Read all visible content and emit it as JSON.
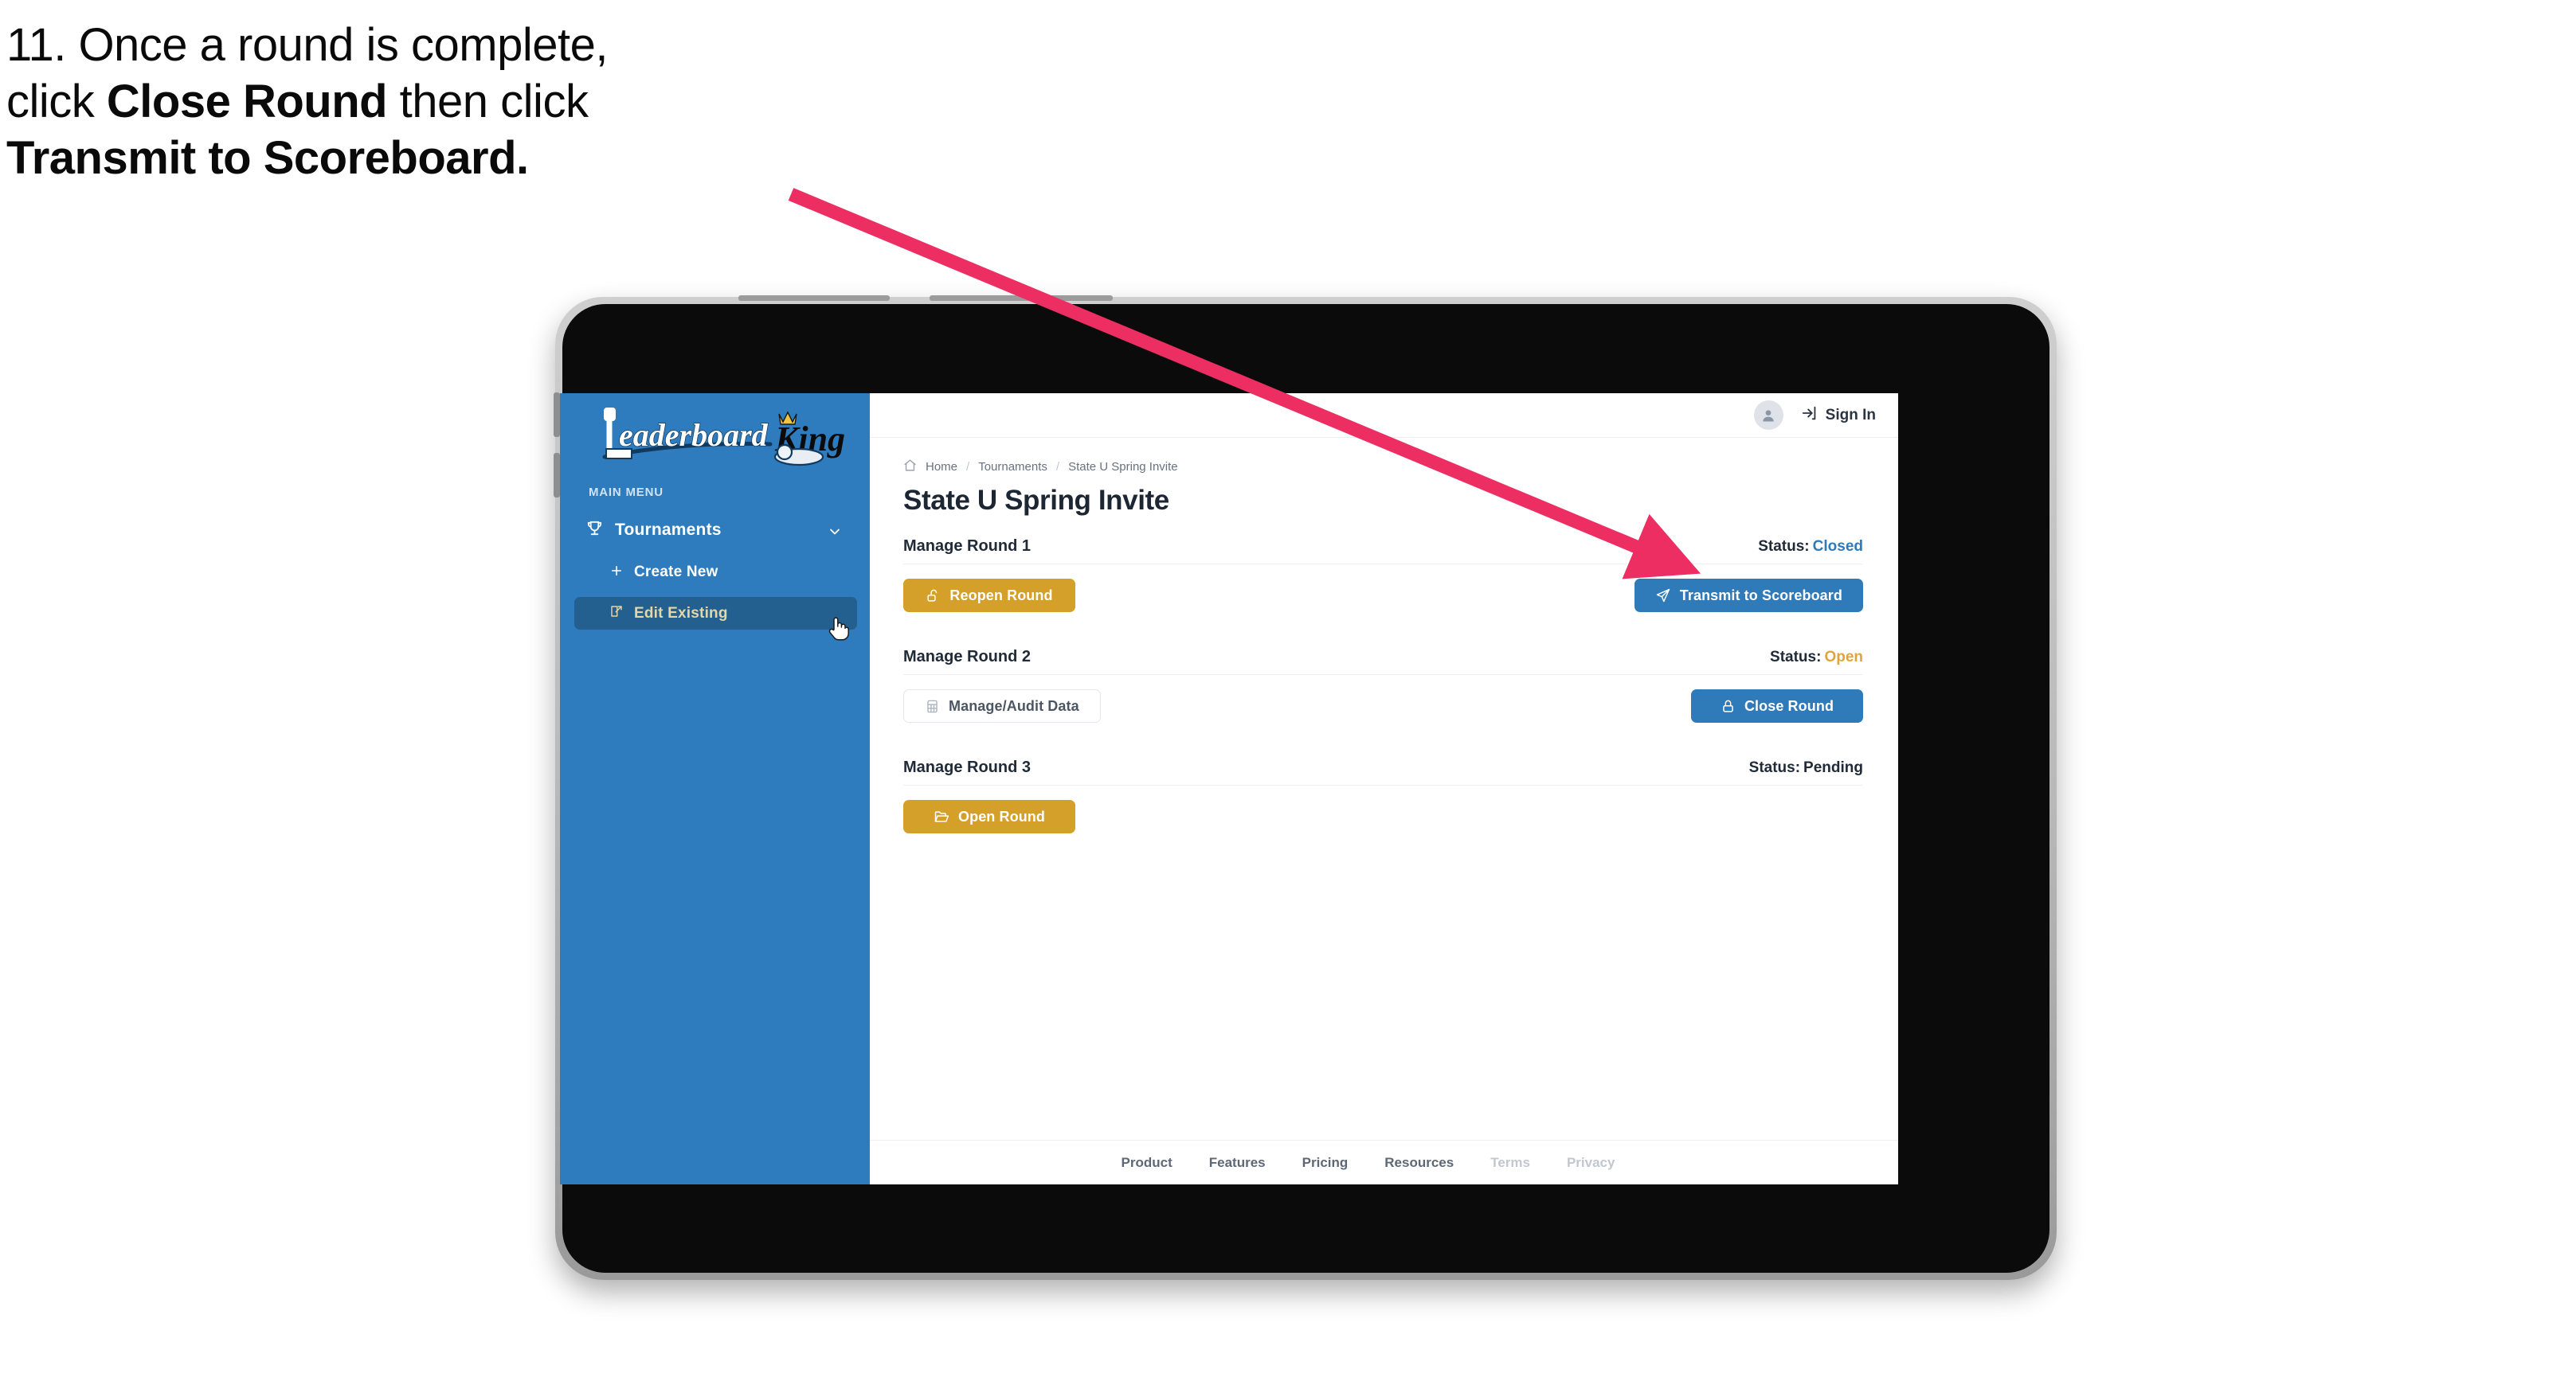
{
  "caption": {
    "line1_prefix": "11. Once a round is complete,",
    "line2_prefix": "click ",
    "line2_bold": "Close Round",
    "line2_suffix": " then click",
    "line3_bold": "Transmit to Scoreboard."
  },
  "annotation": {
    "arrow_color": "#ec2e62",
    "arrow_name": "pointer-arrow"
  },
  "colors": {
    "sidebar_blue": "#2e7cbd",
    "accent_blue": "#2f7ab8",
    "accent_gold": "#d4a029",
    "status_open": "#e0a53a",
    "status_closed": "#2f7ab8",
    "text_dark": "#212b38"
  },
  "sidebar": {
    "logo_primary": "Leaderboard",
    "logo_secondary": "King",
    "menu_label": "MAIN MENU",
    "items": [
      {
        "label": "Tournaments",
        "icon": "trophy-icon",
        "expanded": true
      },
      {
        "label": "Create New",
        "icon": "plus-icon",
        "active": false
      },
      {
        "label": "Edit Existing",
        "icon": "edit-square-icon",
        "active": true
      }
    ]
  },
  "topbar": {
    "avatar_icon": "user-avatar-icon",
    "signin_icon": "sign-in-icon",
    "signin_label": "Sign In"
  },
  "breadcrumb": {
    "home_icon": "home-icon",
    "items": [
      "Home",
      "Tournaments",
      "State U Spring Invite"
    ],
    "separator": "/"
  },
  "page": {
    "title": "State U Spring Invite"
  },
  "rounds": [
    {
      "title": "Manage Round 1",
      "status_label": "Status:",
      "status_value": "Closed",
      "status_class": "st-closed",
      "left_button": {
        "label": "Reopen Round",
        "icon": "unlock-icon",
        "style": "gold"
      },
      "right_button": {
        "label": "Transmit to Scoreboard",
        "icon": "paper-plane-icon",
        "style": "blue"
      }
    },
    {
      "title": "Manage Round 2",
      "status_label": "Status:",
      "status_value": "Open",
      "status_class": "st-open",
      "left_button": {
        "label": "Manage/Audit Data",
        "icon": "table-grid-icon",
        "style": "ghost"
      },
      "right_button": {
        "label": "Close Round",
        "icon": "lock-icon",
        "style": "blue"
      }
    },
    {
      "title": "Manage Round 3",
      "status_label": "Status:",
      "status_value": "Pending",
      "status_class": "st-pending",
      "left_button": {
        "label": "Open Round",
        "icon": "folder-open-icon",
        "style": "gold"
      },
      "right_button": null
    }
  ],
  "footer": {
    "links": [
      {
        "label": "Product",
        "dim": false
      },
      {
        "label": "Features",
        "dim": false
      },
      {
        "label": "Pricing",
        "dim": false
      },
      {
        "label": "Resources",
        "dim": false
      },
      {
        "label": "Terms",
        "dim": true
      },
      {
        "label": "Privacy",
        "dim": true
      }
    ]
  },
  "cursor": {
    "type": "hand-pointer-cursor"
  }
}
